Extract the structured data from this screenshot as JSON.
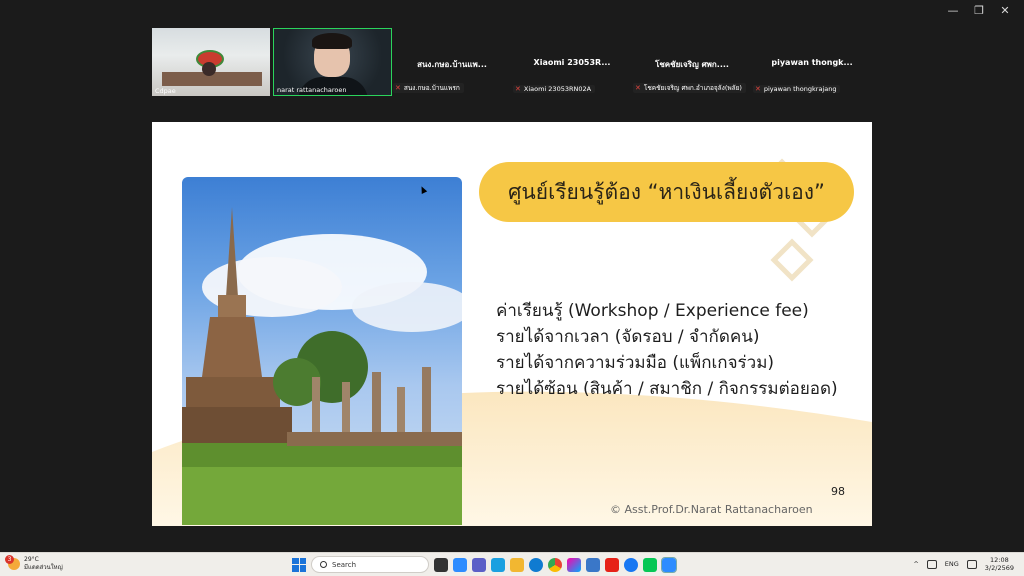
{
  "window": {
    "minimize": "—",
    "restore": "❐",
    "close": "✕"
  },
  "participants": [
    {
      "name": "Cdpae",
      "type": "video-room"
    },
    {
      "name": "narat rattanacharoen",
      "type": "video-person"
    },
    {
      "display": "สนง.กษอ.บ้านแพ...",
      "name": "สนง.กษอ.บ้านแพรก",
      "muted": true
    },
    {
      "display": "Xiaomi 23053R...",
      "name": "Xiaomi 23053RN02A",
      "muted": true
    },
    {
      "display": "โชคชัยเจริญ ศพก....",
      "name": "โชคชัยเจริญ ศพก.อำเภอจุลัง(พลัย)",
      "muted": true
    },
    {
      "display": "piyawan thongk...",
      "name": "piyawan thongkrajang",
      "muted": true
    }
  ],
  "slide": {
    "title": "ศูนย์เรียนรู้ต้อง “หาเงินเลี้ยงตัวเอง”",
    "items": [
      "ค่าเรียนรู้ (Workshop / Experience fee)",
      "รายได้จากเวลา (จัดรอบ / จำกัดคน)",
      "รายได้จากความร่วมมือ (แพ็กเกจร่วม)",
      "รายได้ซ้อน (สินค้า / สมาชิก / กิจกรรมต่อยอด)"
    ],
    "page_number": "98",
    "credit": "© Asst.Prof.Dr.Narat Rattanacharoen",
    "accent_color": "#f6c745"
  },
  "taskbar": {
    "weather_temp": "29°C",
    "weather_desc": "มีแดดส่วนใหญ่",
    "notification_count": "3",
    "search_placeholder": "Search",
    "language": "ENG",
    "time": "12:08",
    "date": "3/2/2569",
    "apps": [
      "file-explorer-icon",
      "zoom-icon-1",
      "teams-icon",
      "edge-icon",
      "folder-icon",
      "edge-browser-icon",
      "chrome-icon",
      "photos-icon",
      "store-icon",
      "youtube-icon",
      "facebook-icon",
      "line-icon",
      "zoom-app-icon"
    ]
  }
}
